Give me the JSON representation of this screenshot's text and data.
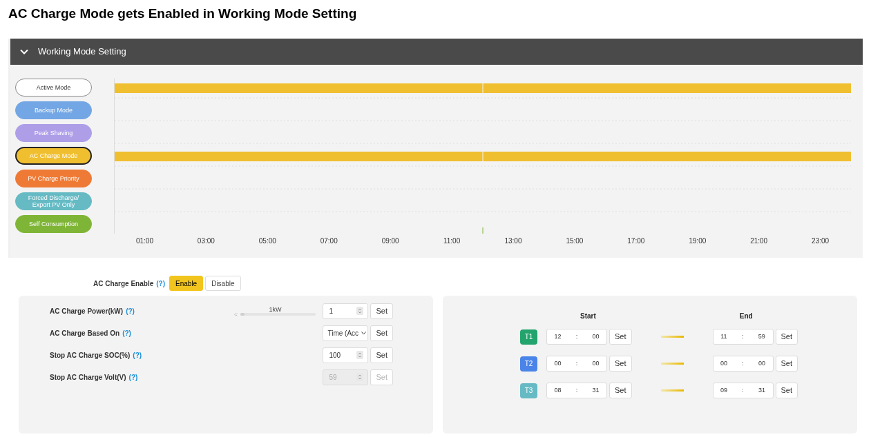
{
  "document_title": "AC Charge Mode gets Enabled in Working Mode Setting",
  "panel": {
    "title": "Working Mode Setting",
    "expanded": true
  },
  "modes": [
    {
      "label": "Active Mode",
      "color": "#ffffff",
      "selected": false,
      "scheduled": true,
      "marker": false
    },
    {
      "label": "Backup Mode",
      "color": "#72a6e4",
      "selected": false,
      "scheduled": false,
      "marker": false
    },
    {
      "label": "Peak Shaving",
      "color": "#ae9ee8",
      "selected": false,
      "scheduled": false,
      "marker": false
    },
    {
      "label": "AC Charge Mode",
      "color": "#f0bf30",
      "selected": true,
      "scheduled": true,
      "marker": false
    },
    {
      "label": "PV Charge Priority",
      "color": "#ef7a35",
      "selected": false,
      "scheduled": false,
      "marker": false
    },
    {
      "label": "Forced Discharge/ Export PV Only",
      "color": "#65bac4",
      "selected": false,
      "scheduled": false,
      "marker": false
    },
    {
      "label": "Self Consumption",
      "color": "#7fb537",
      "selected": false,
      "scheduled": false,
      "marker": true
    }
  ],
  "time_axis_labels": [
    "01:00",
    "03:00",
    "05:00",
    "07:00",
    "09:00",
    "11:00",
    "13:00",
    "15:00",
    "17:00",
    "19:00",
    "21:00",
    "23:00"
  ],
  "ac_charge_enable": {
    "label": "AC Charge Enable",
    "help": "(?)",
    "options": [
      {
        "label": "Enable",
        "selected": true
      },
      {
        "label": "Disable",
        "selected": false
      }
    ]
  },
  "settings": [
    {
      "kind": "slider",
      "label": "AC Charge Power(kW)",
      "help": "(?)",
      "reading": "1kW",
      "level": 0.05,
      "value": "1",
      "disabled": false,
      "button": "Set"
    },
    {
      "kind": "select",
      "label": "AC Charge Based On",
      "help": "(?)",
      "value": "Time (Acc",
      "disabled": false,
      "button": "Set"
    },
    {
      "kind": "number",
      "label": "Stop AC Charge SOC(%)",
      "help": "(?)",
      "value": "100",
      "disabled": false,
      "button": "Set"
    },
    {
      "kind": "number",
      "label": "Stop AC Charge Volt(V)",
      "help": "(?)",
      "value": "59",
      "disabled": true,
      "button": "Set"
    }
  ],
  "time_periods": {
    "start_heading": "Start",
    "end_heading": "End",
    "separator": ":",
    "rows": [
      {
        "tag": "T1",
        "color": "#23a46c",
        "start_hour": "12",
        "start_minute": "00",
        "start_button": "Set",
        "end_hour": "11",
        "end_minute": "59",
        "end_button": "Set"
      },
      {
        "tag": "T2",
        "color": "#4a84e8",
        "start_hour": "00",
        "start_minute": "00",
        "start_button": "Set",
        "end_hour": "00",
        "end_minute": "00",
        "end_button": "Set"
      },
      {
        "tag": "T3",
        "color": "#66bac4",
        "start_hour": "08",
        "start_minute": "31",
        "start_button": "Set",
        "end_hour": "09",
        "end_minute": "31",
        "end_button": "Set"
      }
    ]
  }
}
